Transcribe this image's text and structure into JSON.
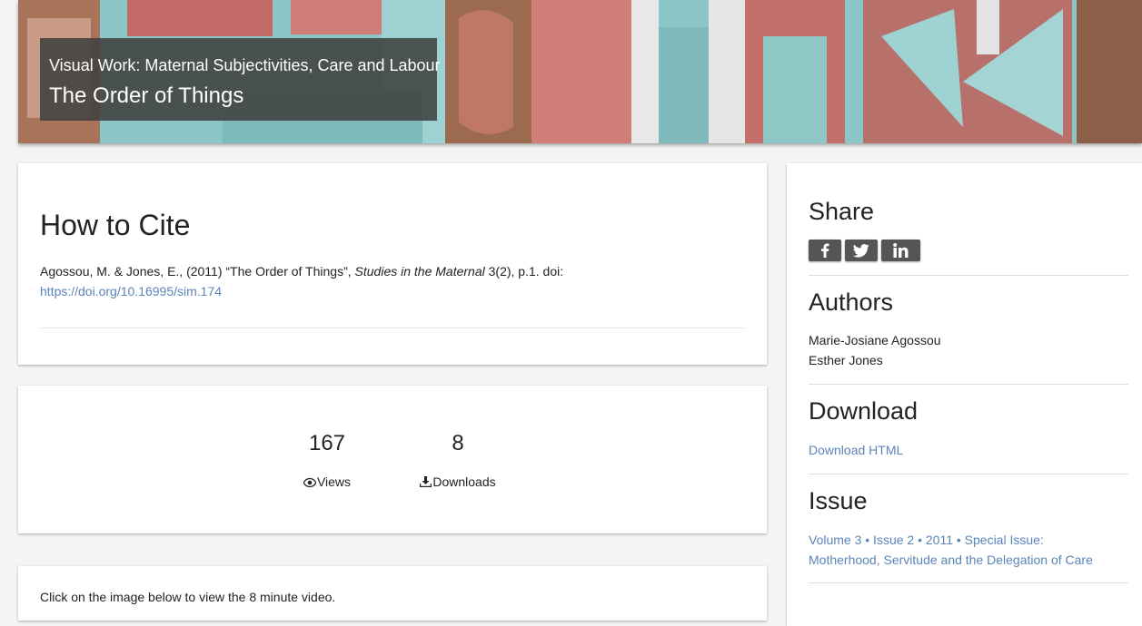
{
  "hero": {
    "subtitle": "Visual Work: Maternal Subjectivities, Care and Labour",
    "title": "The Order of Things"
  },
  "cite": {
    "heading": "How to Cite",
    "authors_year": "Agossou, M. & Jones, E., (2011) “The Order of Things”, ",
    "journal": "Studies in the Maternal",
    "volume_info": " 3(2), p.1. doi: ",
    "doi_link": "https://doi.org/10.16995/sim.174"
  },
  "stats": {
    "views_value": "167",
    "views_label": "Views",
    "downloads_value": "8",
    "downloads_label": "Downloads"
  },
  "video": {
    "text": "Click on the image below to view the 8 minute video."
  },
  "sidebar": {
    "share_heading": "Share",
    "share_buttons": [
      "facebook-icon",
      "twitter-icon",
      "linkedin-icon"
    ],
    "authors_heading": "Authors",
    "authors": [
      "Marie-Josiane Agossou",
      "Esther Jones"
    ],
    "download_heading": "Download",
    "download_link": "Download HTML",
    "issue_heading": "Issue",
    "issue_line1": "Volume 3 • Issue 2 • 2011 • Special Issue:",
    "issue_line2": "Motherhood, Servitude and the Delegation of Care"
  },
  "colors": {
    "link": "#5b84b8",
    "caption_bg": "#404040",
    "share_button": "#555555"
  }
}
